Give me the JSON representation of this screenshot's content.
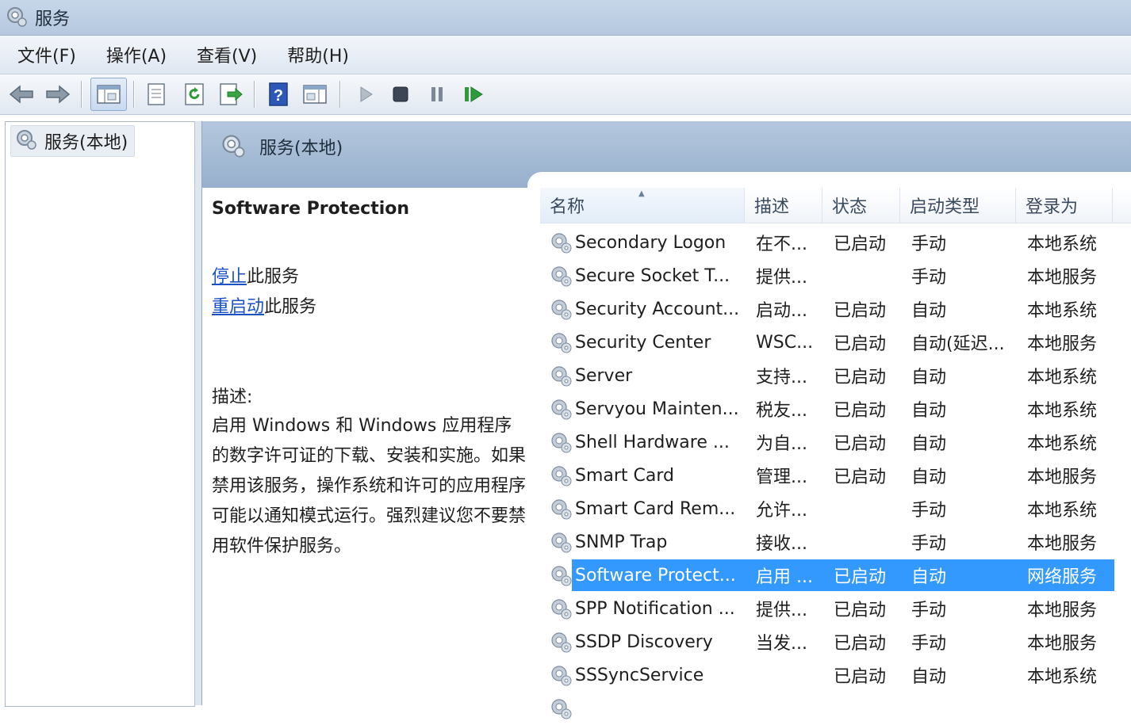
{
  "window": {
    "title": "服务"
  },
  "menu": [
    "文件(F)",
    "操作(A)",
    "查看(V)",
    "帮助(H)"
  ],
  "toolbar_icons": [
    "back-icon",
    "forward-icon",
    "console-tree-icon",
    "properties-icon",
    "refresh-icon",
    "export-list-icon",
    "help-icon",
    "show-hide-icon",
    "start-service-icon",
    "stop-service-icon",
    "pause-service-icon",
    "resume-service-icon"
  ],
  "tree": {
    "root_label": "服务(本地)"
  },
  "pane": {
    "header_title": "服务(本地)",
    "selected_service": "Software Protection",
    "stop_link": "停止",
    "stop_suffix": "此服务",
    "restart_link": "重启动",
    "restart_suffix": "此服务",
    "desc_label": "描述:",
    "desc_text": "启用 Windows 和 Windows 应用程序的数字许可证的下载、安装和实施。如果禁用该服务，操作系统和许可的应用程序可能以通知模式运行。强烈建议您不要禁用软件保护服务。"
  },
  "columns": [
    "名称",
    "描述",
    "状态",
    "启动类型",
    "登录为"
  ],
  "services": [
    {
      "name": "Secondary Logon",
      "desc": "在不...",
      "status": "已启动",
      "startup": "手动",
      "logon": "本地系统"
    },
    {
      "name": "Secure Socket T...",
      "desc": "提供...",
      "status": "",
      "startup": "手动",
      "logon": "本地服务"
    },
    {
      "name": "Security Account...",
      "desc": "启动...",
      "status": "已启动",
      "startup": "自动",
      "logon": "本地系统"
    },
    {
      "name": "Security Center",
      "desc": "WSC...",
      "status": "已启动",
      "startup": "自动(延迟...",
      "logon": "本地服务"
    },
    {
      "name": "Server",
      "desc": "支持...",
      "status": "已启动",
      "startup": "自动",
      "logon": "本地系统"
    },
    {
      "name": "Servyou Mainten...",
      "desc": "税友...",
      "status": "已启动",
      "startup": "自动",
      "logon": "本地系统"
    },
    {
      "name": "Shell Hardware ...",
      "desc": "为自...",
      "status": "已启动",
      "startup": "自动",
      "logon": "本地系统"
    },
    {
      "name": "Smart Card",
      "desc": "管理...",
      "status": "已启动",
      "startup": "自动",
      "logon": "本地服务"
    },
    {
      "name": "Smart Card Rem...",
      "desc": "允许...",
      "status": "",
      "startup": "手动",
      "logon": "本地系统"
    },
    {
      "name": "SNMP Trap",
      "desc": "接收...",
      "status": "",
      "startup": "手动",
      "logon": "本地服务"
    },
    {
      "name": "Software Protect...",
      "desc": "启用 ...",
      "status": "已启动",
      "startup": "自动",
      "logon": "网络服务",
      "selected": true
    },
    {
      "name": "SPP Notification ...",
      "desc": "提供...",
      "status": "已启动",
      "startup": "手动",
      "logon": "本地服务"
    },
    {
      "name": "SSDP Discovery",
      "desc": "当发...",
      "status": "已启动",
      "startup": "手动",
      "logon": "本地服务"
    },
    {
      "name": "SSSyncService",
      "desc": "",
      "status": "已启动",
      "startup": "自动",
      "logon": "本地系统"
    },
    {
      "name": "",
      "desc": "",
      "status": "",
      "startup": "",
      "logon": ""
    }
  ]
}
